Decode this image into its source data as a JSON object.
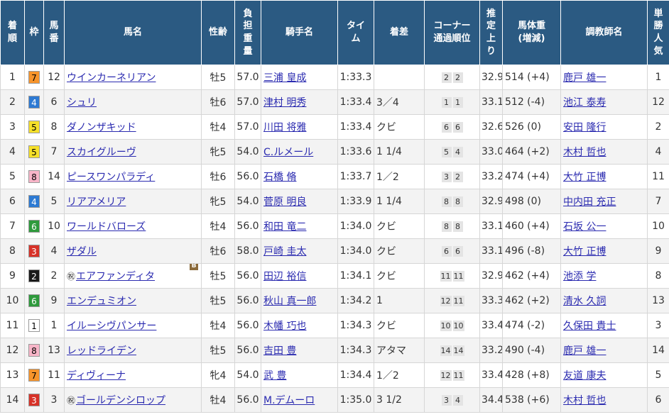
{
  "headers": {
    "rank": [
      "着",
      "順"
    ],
    "waku": "枠",
    "umaban": [
      "馬",
      "番"
    ],
    "horse": "馬名",
    "sexage": "性齢",
    "weight": [
      "負",
      "担",
      "重",
      "量"
    ],
    "jockey": "騎手名",
    "time": [
      "タイ",
      "ム"
    ],
    "margin": "着差",
    "corner": [
      "コーナー",
      "通過順位"
    ],
    "last3f": [
      "推",
      "定",
      "上",
      "り"
    ],
    "bodyweight": [
      "馬体重",
      "(増減)"
    ],
    "trainer": "調教師名",
    "pop": [
      "単",
      "勝",
      "人",
      "気"
    ]
  },
  "rows": [
    {
      "rank": "1",
      "waku": "7",
      "wakuBg": "#f7942b",
      "wakuFg": "#000000",
      "umaban": "12",
      "marker": "",
      "horse": "ウインカーネリアン",
      "blinker": "",
      "sexage": "牡5",
      "weight": "57.0",
      "jockey": "三浦 皇成",
      "time": "1:33.3",
      "margin": "",
      "corner": [
        "2",
        "2"
      ],
      "last3f": "32.9",
      "bodyweight": "514 (+4)",
      "trainer": "鹿戸 雄一",
      "pop": "1"
    },
    {
      "rank": "2",
      "waku": "4",
      "wakuBg": "#2d7ad3",
      "wakuFg": "#ffffff",
      "umaban": "6",
      "marker": "",
      "horse": "シュリ",
      "blinker": "",
      "sexage": "牡6",
      "weight": "57.0",
      "jockey": "津村 明秀",
      "time": "1:33.4",
      "margin": "3／4",
      "corner": [
        "1",
        "1"
      ],
      "last3f": "33.1",
      "bodyweight": "512 (-4)",
      "trainer": "池江 泰寿",
      "pop": "12"
    },
    {
      "rank": "3",
      "waku": "5",
      "wakuBg": "#f6e02a",
      "wakuFg": "#000000",
      "umaban": "8",
      "marker": "",
      "horse": "ダノンザキッド",
      "blinker": "",
      "sexage": "牡4",
      "weight": "57.0",
      "jockey": "川田 将雅",
      "time": "1:33.4",
      "margin": "クビ",
      "corner": [
        "6",
        "6"
      ],
      "last3f": "32.6",
      "bodyweight": "526 (0)",
      "trainer": "安田 隆行",
      "pop": "2"
    },
    {
      "rank": "4",
      "waku": "5",
      "wakuBg": "#f6e02a",
      "wakuFg": "#000000",
      "umaban": "7",
      "marker": "",
      "horse": "スカイグルーヴ",
      "blinker": "",
      "sexage": "牝5",
      "weight": "54.0",
      "jockey": "C.ルメール",
      "time": "1:33.6",
      "margin": "1 1/4",
      "corner": [
        "5",
        "4"
      ],
      "last3f": "33.0",
      "bodyweight": "464 (+2)",
      "trainer": "木村 哲也",
      "pop": "4"
    },
    {
      "rank": "5",
      "waku": "8",
      "wakuBg": "#f8b5c8",
      "wakuFg": "#000000",
      "umaban": "14",
      "marker": "",
      "horse": "ピースワンパラディ",
      "blinker": "",
      "sexage": "牡6",
      "weight": "56.0",
      "jockey": "石橋 脩",
      "time": "1:33.7",
      "margin": "1／2",
      "corner": [
        "3",
        "2"
      ],
      "last3f": "33.2",
      "bodyweight": "474 (+4)",
      "trainer": "大竹 正博",
      "pop": "11"
    },
    {
      "rank": "6",
      "waku": "4",
      "wakuBg": "#2d7ad3",
      "wakuFg": "#ffffff",
      "umaban": "5",
      "marker": "",
      "horse": "リアアメリア",
      "blinker": "",
      "sexage": "牝5",
      "weight": "54.0",
      "jockey": "菅原 明良",
      "time": "1:33.9",
      "margin": "1 1/4",
      "corner": [
        "8",
        "8"
      ],
      "last3f": "32.9",
      "bodyweight": "498 (0)",
      "trainer": "中内田 充正",
      "pop": "7"
    },
    {
      "rank": "7",
      "waku": "6",
      "wakuBg": "#2e9a3c",
      "wakuFg": "#ffffff",
      "umaban": "10",
      "marker": "",
      "horse": "ワールドバローズ",
      "blinker": "",
      "sexage": "牡4",
      "weight": "56.0",
      "jockey": "和田 竜二",
      "time": "1:34.0",
      "margin": "クビ",
      "corner": [
        "8",
        "8"
      ],
      "last3f": "33.1",
      "bodyweight": "460 (+4)",
      "trainer": "石坂 公一",
      "pop": "10"
    },
    {
      "rank": "8",
      "waku": "3",
      "wakuBg": "#d73228",
      "wakuFg": "#ffffff",
      "umaban": "4",
      "marker": "",
      "horse": "ザダル",
      "blinker": "",
      "sexage": "牡6",
      "weight": "58.0",
      "jockey": "戸崎 圭太",
      "time": "1:34.0",
      "margin": "クビ",
      "corner": [
        "6",
        "6"
      ],
      "last3f": "33.1",
      "bodyweight": "496 (-8)",
      "trainer": "大竹 正博",
      "pop": "9"
    },
    {
      "rank": "9",
      "waku": "2",
      "wakuBg": "#1a1a1a",
      "wakuFg": "#ffffff",
      "umaban": "2",
      "marker": "㊗",
      "horse": "エアファンディタ",
      "blinker": "B",
      "sexage": "牡5",
      "weight": "56.0",
      "jockey": "田辺 裕信",
      "time": "1:34.1",
      "margin": "クビ",
      "corner": [
        "11",
        "11"
      ],
      "last3f": "32.9",
      "bodyweight": "462 (+4)",
      "trainer": "池添 学",
      "pop": "8"
    },
    {
      "rank": "10",
      "waku": "6",
      "wakuBg": "#2e9a3c",
      "wakuFg": "#ffffff",
      "umaban": "9",
      "marker": "",
      "horse": "エンデュミオン",
      "blinker": "",
      "sexage": "牡5",
      "weight": "56.0",
      "jockey": "秋山 真一郎",
      "time": "1:34.2",
      "margin": "1",
      "corner": [
        "12",
        "11"
      ],
      "last3f": "33.3",
      "bodyweight": "462 (+2)",
      "trainer": "清水 久詞",
      "pop": "13"
    },
    {
      "rank": "11",
      "waku": "1",
      "wakuBg": "#ffffff",
      "wakuFg": "#000000",
      "umaban": "1",
      "marker": "",
      "horse": "イルーシヴパンサー",
      "blinker": "",
      "sexage": "牡4",
      "weight": "56.0",
      "jockey": "木幡 巧也",
      "time": "1:34.3",
      "margin": "クビ",
      "corner": [
        "10",
        "10"
      ],
      "last3f": "33.4",
      "bodyweight": "474 (-2)",
      "trainer": "久保田 貴士",
      "pop": "3"
    },
    {
      "rank": "12",
      "waku": "8",
      "wakuBg": "#f8b5c8",
      "wakuFg": "#000000",
      "umaban": "13",
      "marker": "",
      "horse": "レッドライデン",
      "blinker": "",
      "sexage": "牡5",
      "weight": "56.0",
      "jockey": "吉田 豊",
      "time": "1:34.3",
      "margin": "アタマ",
      "corner": [
        "14",
        "14"
      ],
      "last3f": "33.2",
      "bodyweight": "490 (-4)",
      "trainer": "鹿戸 雄一",
      "pop": "14"
    },
    {
      "rank": "13",
      "waku": "7",
      "wakuBg": "#f7942b",
      "wakuFg": "#000000",
      "umaban": "11",
      "marker": "",
      "horse": "ディヴィーナ",
      "blinker": "",
      "sexage": "牝4",
      "weight": "54.0",
      "jockey": "武 豊",
      "time": "1:34.4",
      "margin": "1／2",
      "corner": [
        "12",
        "11"
      ],
      "last3f": "33.4",
      "bodyweight": "428 (+8)",
      "trainer": "友道 康夫",
      "pop": "5"
    },
    {
      "rank": "14",
      "waku": "3",
      "wakuBg": "#d73228",
      "wakuFg": "#ffffff",
      "umaban": "3",
      "marker": "㊗",
      "horse": "ゴールデンシロップ",
      "blinker": "",
      "sexage": "牡4",
      "weight": "56.0",
      "jockey": "M.デムーロ",
      "time": "1:35.0",
      "margin": "3 1/2",
      "corner": [
        "3",
        "4"
      ],
      "last3f": "34.4",
      "bodyweight": "538 (+6)",
      "trainer": "木村 哲也",
      "pop": "6"
    }
  ]
}
